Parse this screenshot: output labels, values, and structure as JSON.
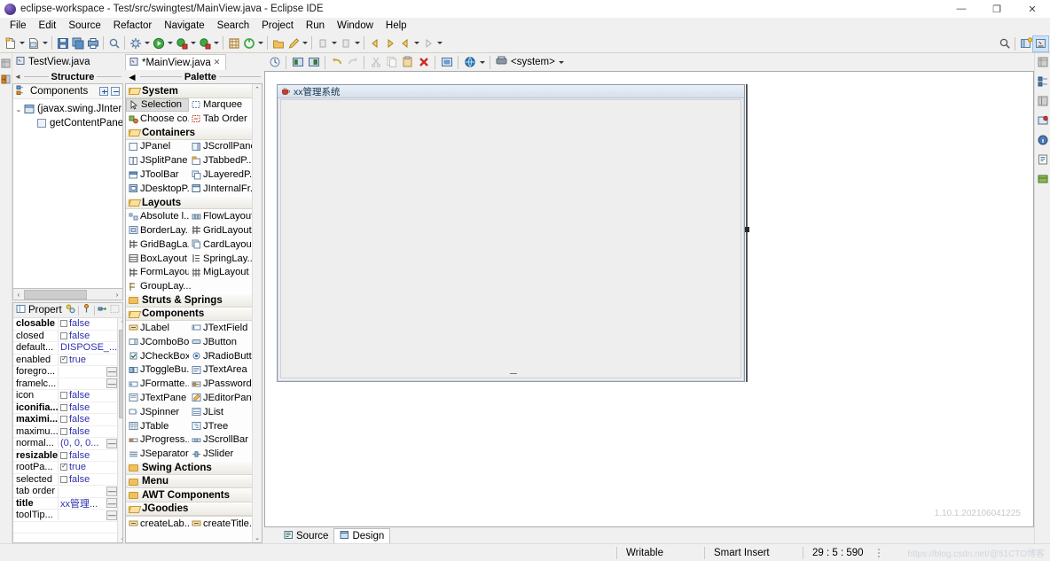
{
  "window": {
    "title": "eclipse-workspace - Test/src/swingtest/MainView.java - Eclipse IDE",
    "minimize": "—",
    "maximize": "❐",
    "close": "✕"
  },
  "menubar": {
    "items": [
      "File",
      "Edit",
      "Source",
      "Refactor",
      "Navigate",
      "Search",
      "Project",
      "Run",
      "Window",
      "Help"
    ]
  },
  "toolbar": {
    "icons": [
      "new-file-icon",
      "new-wizard-icon",
      "save-icon",
      "save-all-icon",
      "print-icon",
      "search-icon",
      "build-icon",
      "run-icon",
      "debug-icon",
      "coverage-icon",
      "new-java-package-icon",
      "external-tools-icon",
      "open-type-icon",
      "marker-icon",
      "previous-annotation-icon",
      "next-annotation-icon",
      "back-icon",
      "forward-icon"
    ],
    "right_icons": [
      "quick-access-search-icon",
      "open-perspective-icon",
      "java-perspective-icon"
    ]
  },
  "left_rail": {
    "icons": [
      "package-explorer-icon",
      "outline-icon"
    ]
  },
  "right_rail": {
    "icons": [
      "package-explorer-icon",
      "outline-icon",
      "properties-icon",
      "problems-icon",
      "javadoc-icon",
      "declaration-icon",
      "servers-icon"
    ]
  },
  "editor_tabs": [
    {
      "label": "TestView.java",
      "active": false,
      "icon": "java-class-icon",
      "dirty": false
    },
    {
      "label": "*MainView.java",
      "active": true,
      "icon": "java-class-icon",
      "dirty": true,
      "close": "✕"
    }
  ],
  "structure": {
    "title": "Structure",
    "collapse_arrow": "◄",
    "components": {
      "label": "Components",
      "expand_all": "expand-all-button",
      "collapse_all": "collapse-all-button",
      "tree": [
        {
          "label": "(javax.swing.JInterna",
          "twisty": "⌄",
          "icon": "internal-frame-icon",
          "indent": 0
        },
        {
          "label": "getContentPane()",
          "twisty": "",
          "icon": "panel-icon",
          "indent": 1
        }
      ]
    },
    "hscroll": {
      "left": "‹",
      "right": "›"
    }
  },
  "properties": {
    "title": "Propert",
    "header_icons": [
      "show-advanced-properties-icon",
      "show-events-icon",
      "goto-definition-icon",
      "restore-default-icon"
    ],
    "rows": [
      {
        "name": "closable",
        "bold": true,
        "value": "false",
        "kind": "checkbox",
        "checked": false,
        "ellipsis": false
      },
      {
        "name": "closed",
        "bold": false,
        "value": "false",
        "kind": "checkbox",
        "checked": false,
        "ellipsis": false
      },
      {
        "name": "default...",
        "bold": false,
        "value": "DISPOSE_...",
        "kind": "text",
        "checked": false,
        "ellipsis": false
      },
      {
        "name": "enabled",
        "bold": false,
        "value": "true",
        "kind": "checkbox",
        "checked": true,
        "ellipsis": false
      },
      {
        "name": "foregro...",
        "bold": false,
        "value": "",
        "kind": "text",
        "checked": false,
        "ellipsis": true
      },
      {
        "name": "framelc...",
        "bold": false,
        "value": "",
        "kind": "text",
        "checked": false,
        "ellipsis": true
      },
      {
        "name": "icon",
        "bold": false,
        "value": "false",
        "kind": "checkbox",
        "checked": false,
        "ellipsis": false
      },
      {
        "name": "iconifia...",
        "bold": true,
        "value": "false",
        "kind": "checkbox",
        "checked": false,
        "ellipsis": false
      },
      {
        "name": "maximi...",
        "bold": true,
        "value": "false",
        "kind": "checkbox",
        "checked": false,
        "ellipsis": false
      },
      {
        "name": "maximu...",
        "bold": false,
        "value": "false",
        "kind": "checkbox",
        "checked": false,
        "ellipsis": false
      },
      {
        "name": "normal...",
        "bold": false,
        "value": "(0, 0, 0...",
        "kind": "text",
        "checked": false,
        "ellipsis": true
      },
      {
        "name": "resizable",
        "bold": true,
        "value": "false",
        "kind": "checkbox",
        "checked": false,
        "ellipsis": false
      },
      {
        "name": "rootPa...",
        "bold": false,
        "value": "true",
        "kind": "checkbox",
        "checked": true,
        "ellipsis": false
      },
      {
        "name": "selected",
        "bold": false,
        "value": "false",
        "kind": "checkbox",
        "checked": false,
        "ellipsis": false
      },
      {
        "name": "tab order",
        "bold": false,
        "value": "",
        "kind": "text",
        "checked": false,
        "ellipsis": true
      },
      {
        "name": "title",
        "bold": true,
        "value": "xx管理...",
        "kind": "text",
        "checked": false,
        "ellipsis": true
      },
      {
        "name": "toolTip...",
        "bold": false,
        "value": "",
        "kind": "text",
        "checked": false,
        "ellipsis": true
      }
    ]
  },
  "palette": {
    "title": "Palette",
    "collapse_arrow": "◄",
    "scroll_up": "⌃",
    "scroll_down": "⌄",
    "categories": [
      {
        "name": "System",
        "open": true,
        "items": [
          {
            "label": "Selection",
            "icon": "selection-cursor-icon",
            "selected": true
          },
          {
            "label": "Marquee",
            "icon": "marquee-icon",
            "selected": false
          },
          {
            "label": "Choose co...",
            "icon": "choose-component-icon",
            "selected": false
          },
          {
            "label": "Tab Order",
            "icon": "tab-order-icon",
            "selected": false
          }
        ]
      },
      {
        "name": "Containers",
        "open": true,
        "items": [
          {
            "label": "JPanel",
            "icon": "jpanel-icon"
          },
          {
            "label": "JScrollPane",
            "icon": "jscrollpane-icon"
          },
          {
            "label": "JSplitPane",
            "icon": "jsplitpane-icon"
          },
          {
            "label": "JTabbedP...",
            "icon": "jtabbedpane-icon"
          },
          {
            "label": "JToolBar",
            "icon": "jtoolbar-icon"
          },
          {
            "label": "JLayeredP...",
            "icon": "jlayeredpane-icon"
          },
          {
            "label": "JDesktopP...",
            "icon": "jdesktoppane-icon"
          },
          {
            "label": "JInternalFr...",
            "icon": "jinternalframe-icon"
          }
        ]
      },
      {
        "name": "Layouts",
        "open": true,
        "items": [
          {
            "label": "Absolute l...",
            "icon": "absolute-layout-icon"
          },
          {
            "label": "FlowLayout",
            "icon": "flow-layout-icon"
          },
          {
            "label": "BorderLay...",
            "icon": "border-layout-icon"
          },
          {
            "label": "GridLayout",
            "icon": "grid-layout-icon"
          },
          {
            "label": "GridBagLa...",
            "icon": "gridbag-layout-icon"
          },
          {
            "label": "CardLayout",
            "icon": "card-layout-icon"
          },
          {
            "label": "BoxLayout",
            "icon": "box-layout-icon"
          },
          {
            "label": "SpringLay...",
            "icon": "spring-layout-icon"
          },
          {
            "label": "FormLayout",
            "icon": "form-layout-icon"
          },
          {
            "label": "MigLayout",
            "icon": "mig-layout-icon"
          },
          {
            "label": "GroupLay...",
            "icon": "group-layout-icon"
          }
        ]
      },
      {
        "name": "Struts & Springs",
        "open": false,
        "items": []
      },
      {
        "name": "Components",
        "open": true,
        "items": [
          {
            "label": "JLabel",
            "icon": "jlabel-icon"
          },
          {
            "label": "JTextField",
            "icon": "jtextfield-icon"
          },
          {
            "label": "JComboBox",
            "icon": "jcombobox-icon"
          },
          {
            "label": "JButton",
            "icon": "jbutton-icon"
          },
          {
            "label": "JCheckBox",
            "icon": "jcheckbox-icon"
          },
          {
            "label": "JRadioButt...",
            "icon": "jradiobutton-icon"
          },
          {
            "label": "JToggleBu...",
            "icon": "jtogglebutton-icon"
          },
          {
            "label": "JTextArea",
            "icon": "jtextarea-icon"
          },
          {
            "label": "JFormatte...",
            "icon": "jformattedtextfield-icon"
          },
          {
            "label": "JPassword...",
            "icon": "jpasswordfield-icon"
          },
          {
            "label": "JTextPane",
            "icon": "jtextpane-icon"
          },
          {
            "label": "JEditorPane",
            "icon": "jeditorpane-icon"
          },
          {
            "label": "JSpinner",
            "icon": "jspinner-icon"
          },
          {
            "label": "JList",
            "icon": "jlist-icon"
          },
          {
            "label": "JTable",
            "icon": "jtable-icon"
          },
          {
            "label": "JTree",
            "icon": "jtree-icon"
          },
          {
            "label": "JProgress...",
            "icon": "jprogressbar-icon"
          },
          {
            "label": "JScrollBar",
            "icon": "jscrollbar-icon"
          },
          {
            "label": "JSeparator",
            "icon": "jseparator-icon"
          },
          {
            "label": "JSlider",
            "icon": "jslider-icon"
          }
        ]
      },
      {
        "name": "Swing Actions",
        "open": false,
        "items": []
      },
      {
        "name": "Menu",
        "open": false,
        "items": []
      },
      {
        "name": "AWT Components",
        "open": false,
        "items": []
      },
      {
        "name": "JGoodies",
        "open": true,
        "items": []
      }
    ],
    "footer_items": [
      {
        "label": "createLab...",
        "icon": "create-label-icon"
      },
      {
        "label": "createTitle...",
        "icon": "create-title-icon"
      }
    ]
  },
  "design": {
    "toolbar_icons": [
      "test-refresh-icon",
      "open-source-icon",
      "open-design-icon",
      "undo-icon",
      "redo-icon",
      "cut-icon",
      "copy-icon",
      "paste-icon",
      "delete-icon",
      "preview-icon",
      "locale-globe-icon"
    ],
    "locale_dropdown": "▾",
    "look_and_feel": "<system>",
    "look_and_feel_dropdown": "▾",
    "internal_frame": {
      "title": "xx管理系统",
      "icon": "java-coffee-cup-icon"
    },
    "version": "1.10.1.202106041225"
  },
  "bottom_tabs": [
    {
      "label": "Source",
      "active": false,
      "icon": "source-icon"
    },
    {
      "label": "Design",
      "active": true,
      "icon": "design-icon"
    }
  ],
  "statusbar": {
    "writable": "Writable",
    "insert_mode": "Smart Insert",
    "cursor_position": "29 : 5 : 590",
    "watermark": "https://blog.csdn.net/@51CTO博客"
  },
  "colors": {
    "accent": "#2f2fb0",
    "titlebar_bg": "#ffffff",
    "chrome_bg": "#f0f0f0",
    "canvas_bg": "#ffffff",
    "frame_title_bg": "#d5e0ec"
  }
}
